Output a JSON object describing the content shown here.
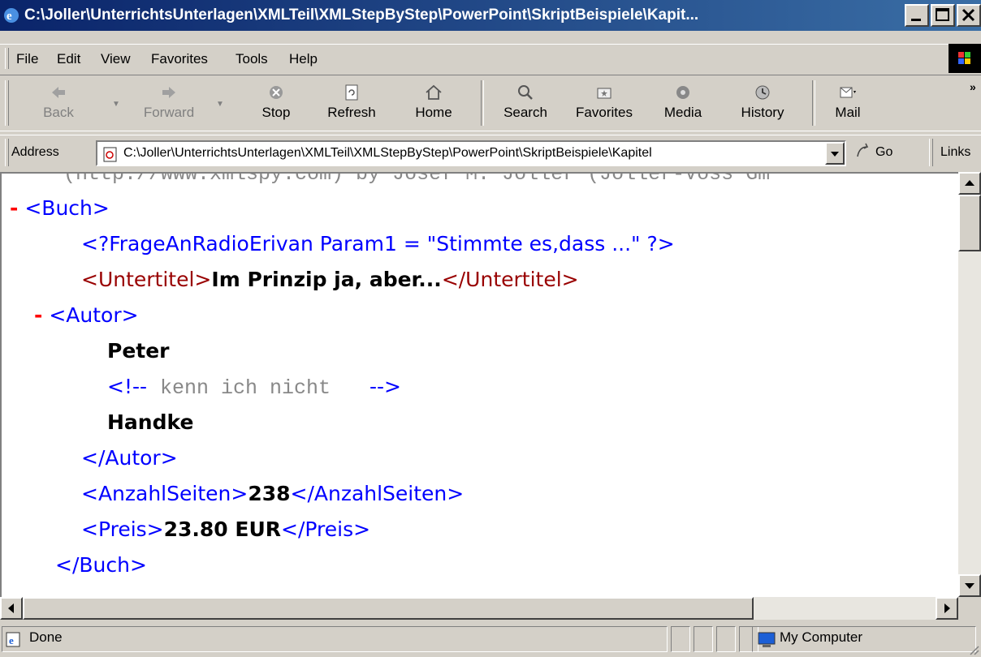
{
  "window": {
    "title": "C:\\Joller\\UnterrichtsUnterlagen\\XMLTeil\\XMLStepByStep\\PowerPoint\\SkriptBeispiele\\Kapit..."
  },
  "menu": [
    "File",
    "Edit",
    "View",
    "Favorites",
    "Tools",
    "Help"
  ],
  "toolbar": {
    "back": "Back",
    "forward": "Forward",
    "stop": "Stop",
    "refresh": "Refresh",
    "home": "Home",
    "search": "Search",
    "favorites": "Favorites",
    "media": "Media",
    "history": "History",
    "mail": "Mail"
  },
  "address": {
    "label": "Address",
    "value": "C:\\Joller\\UnterrichtsUnterlagen\\XMLTeil\\XMLStepByStep\\PowerPoint\\SkriptBeispiele\\Kapitel",
    "go": "Go",
    "links": "Links"
  },
  "document": {
    "header_fragment": "(http://www.xmlspy.com) by Josef M. Joller (Joller-Voss Gm",
    "buch_open": "<Buch>",
    "pi": "<?FrageAnRadioErivan Param1 = \"Stimmte es,dass ...\" ?>",
    "untertitel_open": "<Untertitel>",
    "untertitel_text": "Im Prinzip ja, aber...",
    "untertitel_close": "</Untertitel>",
    "autor_open": "<Autor>",
    "autor_first": "Peter",
    "comment_open": "<!--",
    "comment_text": "kenn ich nicht",
    "comment_close": "-->",
    "autor_last": "Handke",
    "autor_close": "</Autor>",
    "seiten_open": "<AnzahlSeiten>",
    "seiten_value": "238",
    "seiten_close": "</AnzahlSeiten>",
    "preis_open": "<Preis>",
    "preis_value": "23.80 EUR",
    "preis_close": "</Preis>",
    "buch_close": "</Buch>",
    "collapse_marker": "-"
  },
  "status": {
    "text": "Done",
    "zone": "My Computer"
  }
}
